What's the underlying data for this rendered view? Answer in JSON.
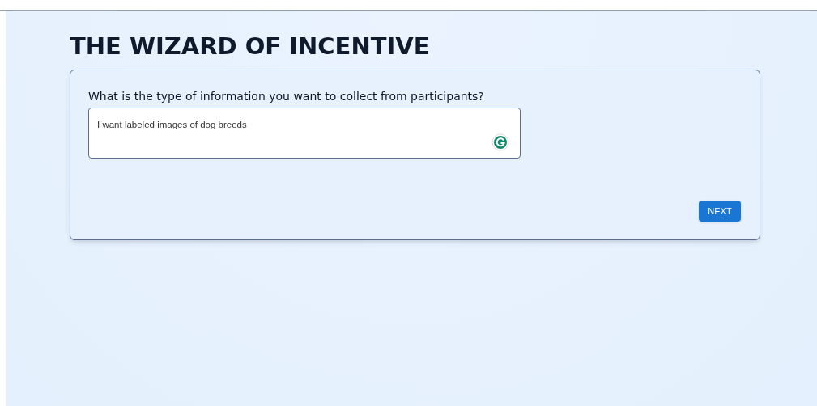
{
  "title": "THE WIZARD OF INCENTIVE",
  "question": {
    "label": "What is the type of information you want to collect from participants?",
    "value": "I want labeled images of dog breeds"
  },
  "buttons": [
    {
      "label": "NEXT"
    }
  ]
}
